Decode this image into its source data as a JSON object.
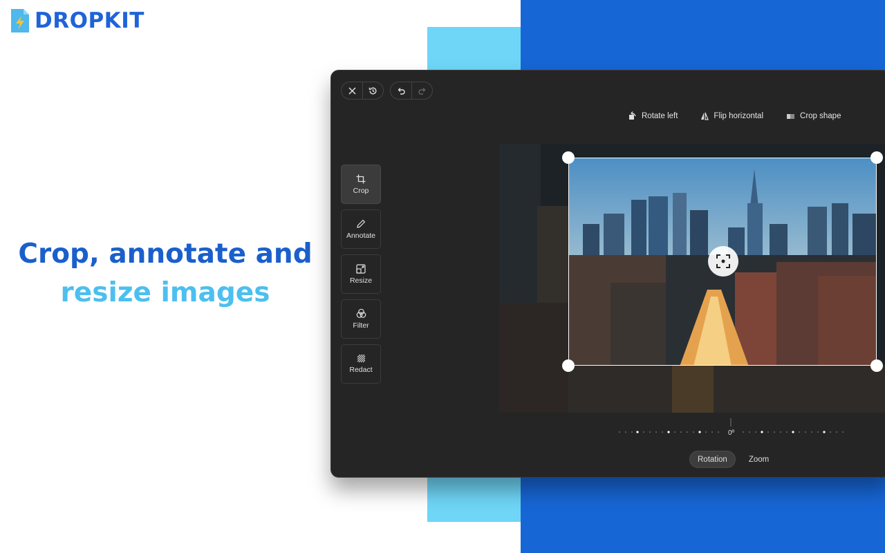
{
  "brand": {
    "name": "DROPKIT"
  },
  "headline": {
    "line1": "Crop, annotate and",
    "line2": "resize images"
  },
  "toolbar": {
    "left_group": [
      {
        "icon": "close-icon"
      },
      {
        "icon": "history-icon"
      }
    ],
    "history_group": [
      {
        "icon": "undo-icon"
      },
      {
        "icon": "redo-icon"
      }
    ],
    "tools": [
      {
        "label": "Rotate left",
        "icon": "rotate-left-icon"
      },
      {
        "label": "Flip horizontal",
        "icon": "flip-horizontal-icon"
      },
      {
        "label": "Crop shape",
        "icon": "crop-shape-icon"
      }
    ]
  },
  "sidebar": {
    "items": [
      {
        "label": "Crop",
        "icon": "crop-icon",
        "active": true
      },
      {
        "label": "Annotate",
        "icon": "pencil-icon",
        "active": false
      },
      {
        "label": "Resize",
        "icon": "resize-icon",
        "active": false
      },
      {
        "label": "Filter",
        "icon": "filter-icon",
        "active": false
      },
      {
        "label": "Redact",
        "icon": "redact-icon",
        "active": false
      }
    ]
  },
  "rotation": {
    "value_label": "0º"
  },
  "bottom_tabs": [
    {
      "label": "Rotation",
      "active": true
    },
    {
      "label": "Zoom",
      "active": false
    }
  ],
  "colors": {
    "brand_blue": "#1766d6",
    "accent_cyan": "#6fd6f7",
    "panel": "#252525"
  }
}
